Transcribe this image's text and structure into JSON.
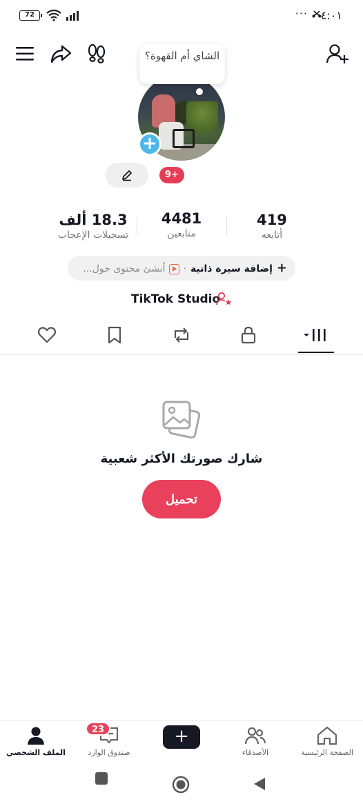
{
  "status_bar": {
    "battery": "72",
    "time": "٤:٠١",
    "dots": "···"
  },
  "profile": {
    "note_bubble": "الشاي أم القهوة؟",
    "notifications_badge": "9+",
    "stats": {
      "likes_value": "18.3 ألف",
      "likes_label": "تسجيلات الإعجاب",
      "followers_value": "4481",
      "followers_label": "متابعين",
      "following_value": "419",
      "following_label": "أتابعه"
    },
    "bio_bar": {
      "add_bio_label": "إضافة سيرة ذاتية",
      "separator": "·",
      "hint": "أنشئ محتوى حول..."
    },
    "studio_label": "TikTok Studio"
  },
  "tabs": [
    {
      "name": "videos",
      "active": true
    },
    {
      "name": "private"
    },
    {
      "name": "reposts"
    },
    {
      "name": "favorites"
    },
    {
      "name": "liked"
    }
  ],
  "empty_state": {
    "title": "شارك صورتك الأكثر شعبية",
    "button_label": "تحميل"
  },
  "bottom_nav": {
    "profile": "الملف الشخصي",
    "inbox": "صندوق الوارد",
    "inbox_badge": "23",
    "create": "+",
    "friends": "الأصدقاء",
    "home": "الصفحة الرئيسية"
  },
  "colors": {
    "accent": "#e9405c",
    "text": "#161823",
    "muted": "#777777"
  }
}
